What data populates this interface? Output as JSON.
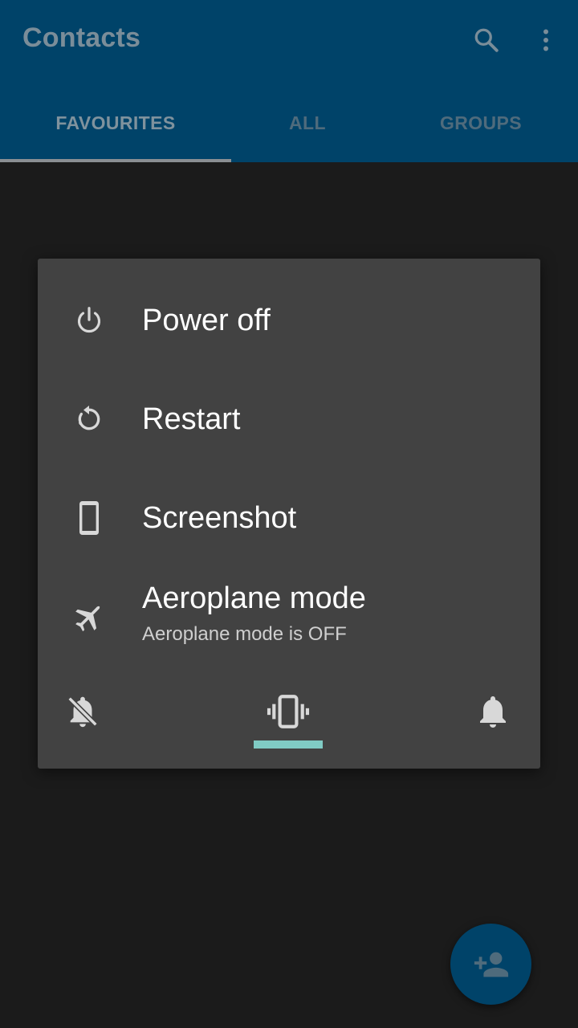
{
  "appbar": {
    "title": "Contacts",
    "icons": {
      "search": "search-icon",
      "more": "more-vert-icon"
    },
    "tabs": [
      {
        "label": "FAVOURITES",
        "selected": true
      },
      {
        "label": "ALL",
        "selected": false
      },
      {
        "label": "GROUPS",
        "selected": false
      }
    ]
  },
  "power_menu": {
    "items": [
      {
        "label": "Power off",
        "icon": "power-icon"
      },
      {
        "label": "Restart",
        "icon": "restart-icon"
      },
      {
        "label": "Screenshot",
        "icon": "phone-screenshot-icon"
      },
      {
        "label": "Aeroplane mode",
        "sublabel": "Aeroplane mode is OFF",
        "icon": "airplane-icon"
      }
    ],
    "sound_modes": [
      {
        "name": "silent",
        "icon": "bell-off-icon",
        "selected": false
      },
      {
        "name": "vibrate",
        "icon": "vibrate-icon",
        "selected": true
      },
      {
        "name": "sound",
        "icon": "bell-icon",
        "selected": false
      }
    ],
    "accent": "#80cbc4"
  },
  "fab": {
    "icon": "add-person-icon"
  },
  "colors": {
    "appbar": "#004369",
    "dialog": "#424242",
    "background": "#1b1b1b"
  }
}
